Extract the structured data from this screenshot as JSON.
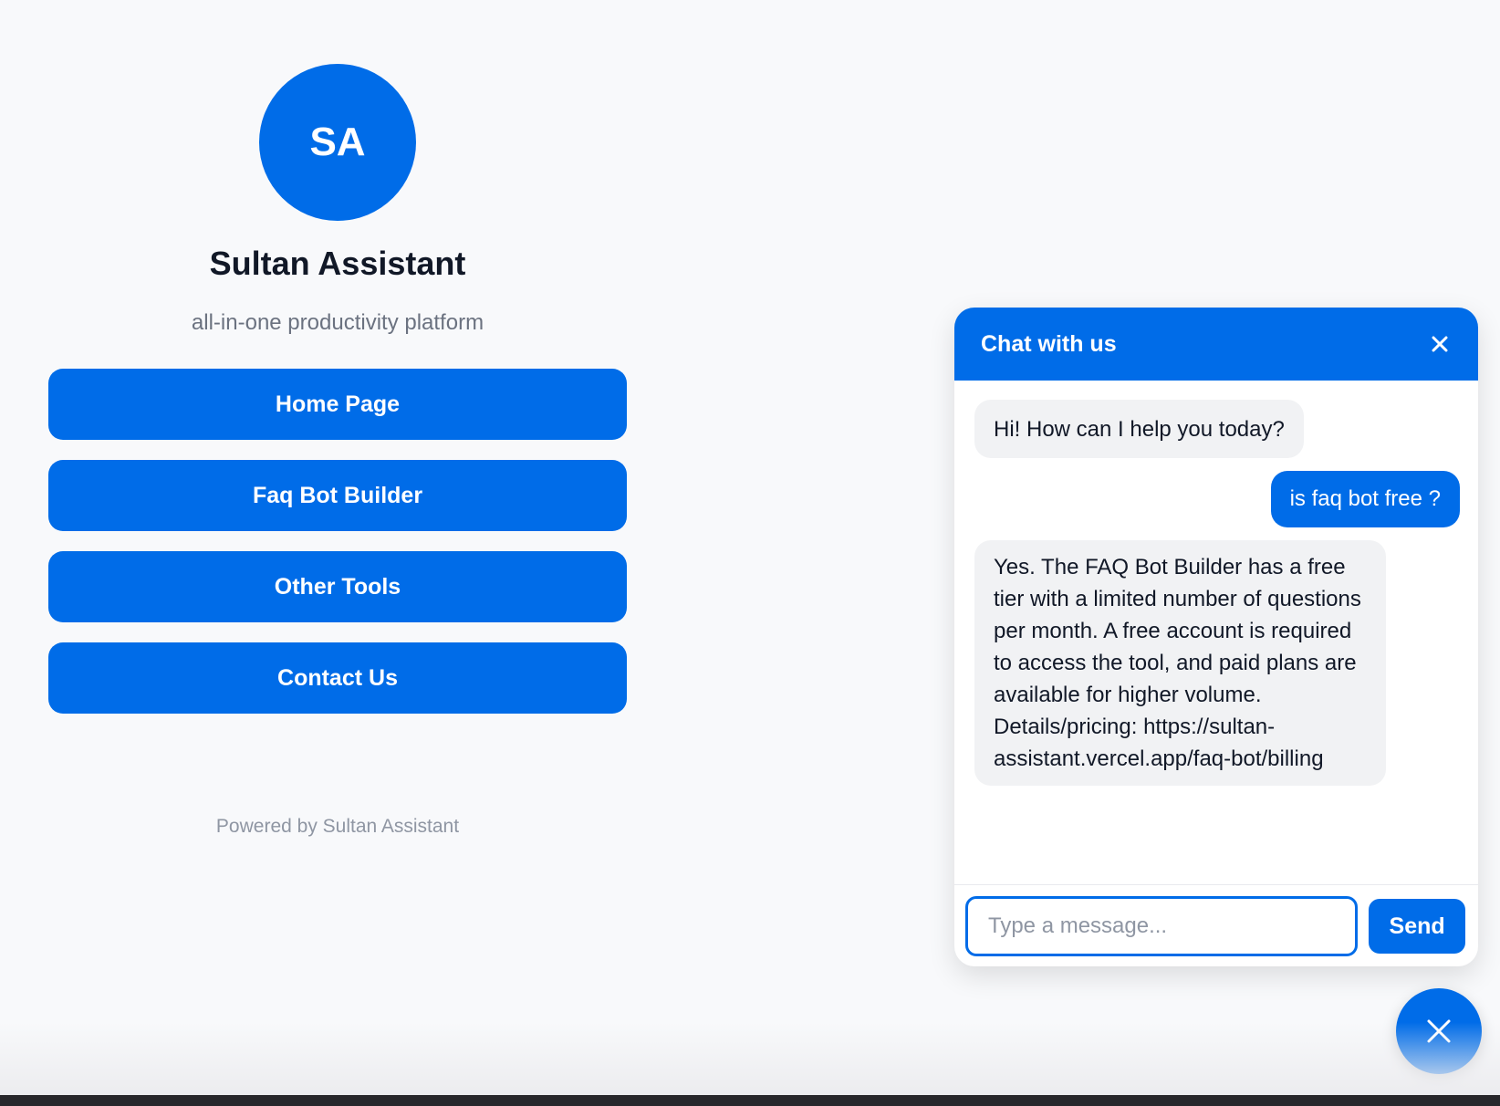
{
  "profile": {
    "avatar_initials": "SA",
    "name": "Sultan Assistant",
    "tagline": "all-in-one productivity platform",
    "links": [
      {
        "label": "Home Page"
      },
      {
        "label": "Faq Bot Builder"
      },
      {
        "label": "Other Tools"
      },
      {
        "label": "Contact Us"
      }
    ],
    "footer": "Powered by Sultan Assistant"
  },
  "chat": {
    "title": "Chat with us",
    "close_icon": "close-icon",
    "messages": [
      {
        "role": "bot",
        "text": "Hi! How can I help you today?"
      },
      {
        "role": "user",
        "text": "is faq bot free ?"
      },
      {
        "role": "bot",
        "text": "Yes. The FAQ Bot Builder has a free tier with a limited number of questions per month. A free account is required to access the tool, and paid plans are available for higher volume. Details/pricing: https://sultan-assistant.vercel.app/faq-bot/billing"
      }
    ],
    "input": {
      "placeholder": "Type a message...",
      "value": ""
    },
    "send_label": "Send"
  },
  "fab": {
    "icon": "close-icon"
  },
  "colors": {
    "accent": "#006ce8",
    "background": "#f8f9fb",
    "bot_bubble": "#f1f2f4"
  }
}
